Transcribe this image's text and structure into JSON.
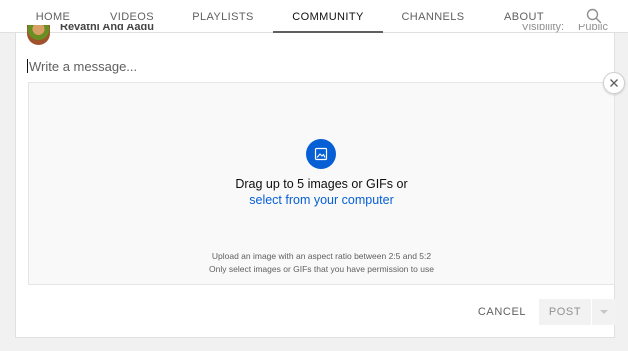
{
  "tabs": [
    {
      "label": "HOME"
    },
    {
      "label": "VIDEOS"
    },
    {
      "label": "PLAYLISTS"
    },
    {
      "label": "COMMUNITY",
      "active": true
    },
    {
      "label": "CHANNELS"
    },
    {
      "label": "ABOUT"
    }
  ],
  "search": {
    "icon": "search-icon"
  },
  "post_header": {
    "author": "Revathi And Aadu",
    "visibility_label": "Visibility:",
    "visibility_value": "Public"
  },
  "composer": {
    "placeholder": "Write a message...",
    "value": ""
  },
  "upload": {
    "icon": "image-icon",
    "drag_text": "Drag up to 5 images or GIFs or",
    "select_link": "select from your computer",
    "hint_aspect": "Upload an image with an aspect ratio between 2:5 and 5:2",
    "hint_permission": "Only select images or GIFs that you have permission to use"
  },
  "actions": {
    "cancel_label": "CANCEL",
    "post_label": "POST",
    "post_menu_icon": "caret-down-icon"
  },
  "colors": {
    "accent_blue": "#065fd4",
    "text_primary": "#0f0f0f",
    "text_secondary": "#606060"
  }
}
